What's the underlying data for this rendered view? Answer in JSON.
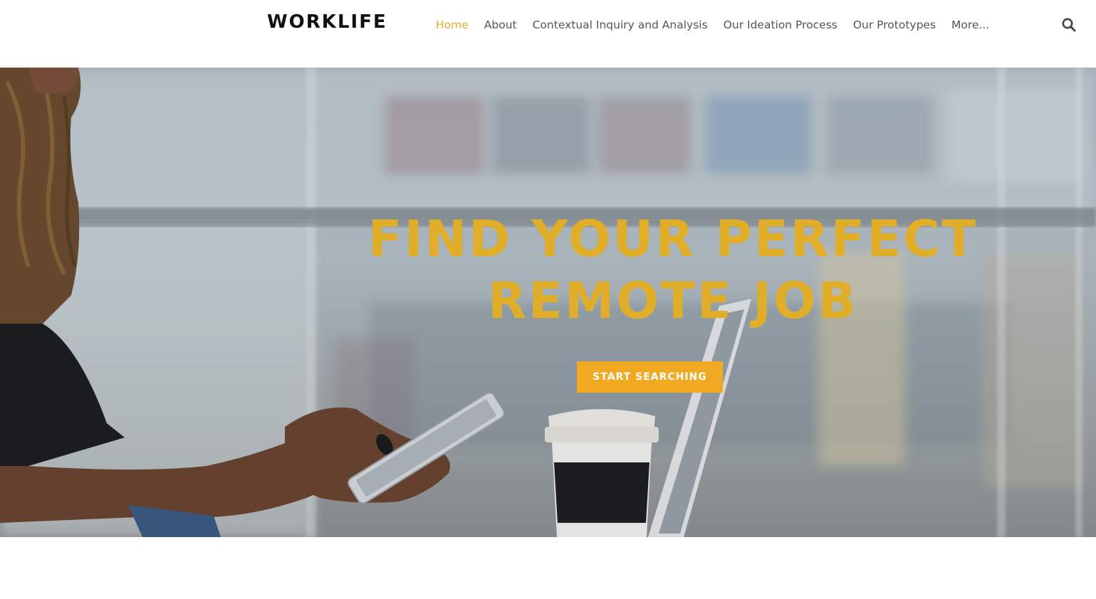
{
  "brand": {
    "name": "WORKLIFE"
  },
  "nav": {
    "items": [
      {
        "label": "Home",
        "active": true
      },
      {
        "label": "About"
      },
      {
        "label": "Contextual Inquiry and Analysis"
      },
      {
        "label": "Our Ideation Process"
      },
      {
        "label": "Our Prototypes"
      },
      {
        "label": "More..."
      }
    ],
    "search_icon": "search-icon",
    "accent_color": "#f0a830"
  },
  "hero": {
    "title_line1": "FIND YOUR PERFECT",
    "title_line2": "REMOTE JOB",
    "cta_label": "START SEARCHING",
    "title_color": "#e0ae28",
    "cta_color": "#f2a922"
  }
}
